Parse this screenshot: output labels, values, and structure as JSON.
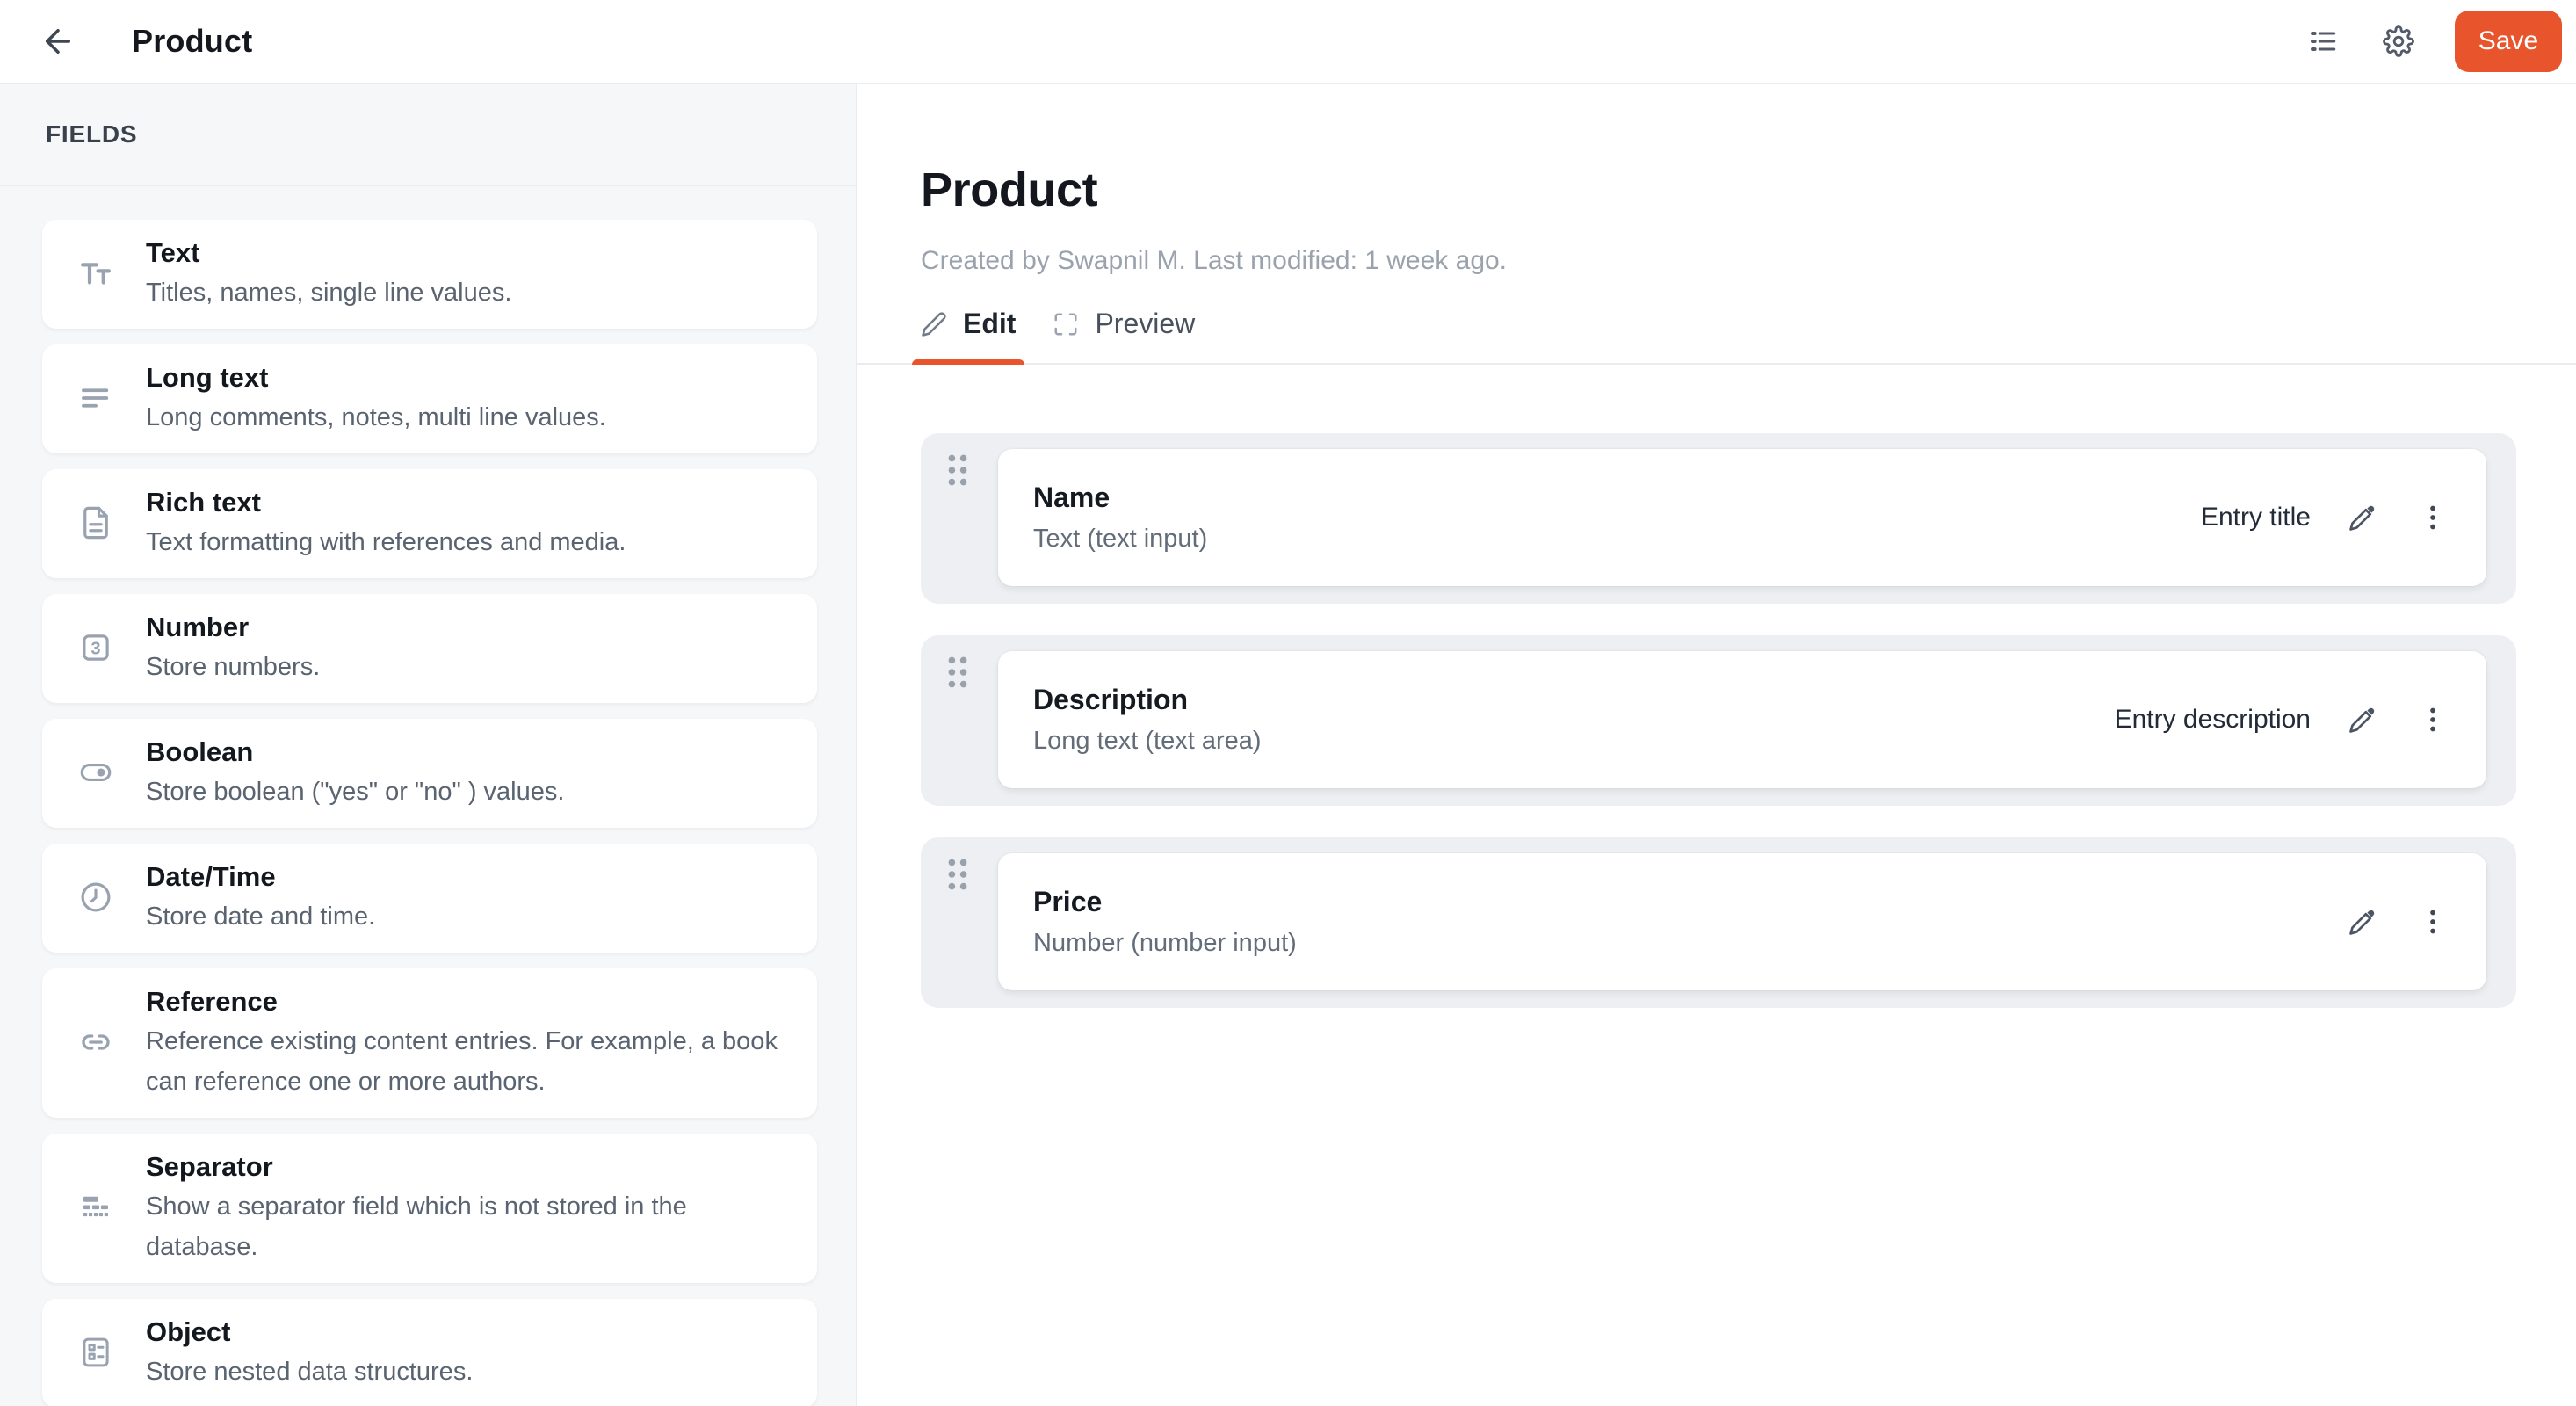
{
  "colors": {
    "accent": "#E8552D"
  },
  "topbar": {
    "back_icon": "arrow-left-icon",
    "title": "Product",
    "list_icon": "list-icon",
    "gear_icon": "gear-icon",
    "save_label": "Save"
  },
  "sidebar": {
    "header": "FIELDS",
    "items": [
      {
        "icon": "text-icon",
        "title": "Text",
        "description": "Titles, names, single line values."
      },
      {
        "icon": "long-text-icon",
        "title": "Long text",
        "description": "Long comments, notes, multi line values."
      },
      {
        "icon": "rich-text-icon",
        "title": "Rich text",
        "description": "Text formatting with references and media."
      },
      {
        "icon": "number-icon",
        "title": "Number",
        "description": "Store numbers."
      },
      {
        "icon": "boolean-icon",
        "title": "Boolean",
        "description": "Store boolean (\"yes\" or \"no\" ) values."
      },
      {
        "icon": "datetime-icon",
        "title": "Date/Time",
        "description": "Store date and time."
      },
      {
        "icon": "reference-icon",
        "title": "Reference",
        "description": "Reference existing content entries. For example, a book can reference one or more authors."
      },
      {
        "icon": "separator-icon",
        "title": "Separator",
        "description": "Show a separator field which is not stored in the database."
      },
      {
        "icon": "object-icon",
        "title": "Object",
        "description": "Store nested data structures."
      }
    ]
  },
  "main": {
    "title": "Product",
    "meta": "Created by Swapnil M. Last modified: 1 week ago.",
    "tabs": [
      {
        "icon": "pencil-icon",
        "label": "Edit",
        "active": true
      },
      {
        "icon": "expand-icon",
        "label": "Preview",
        "active": false
      }
    ],
    "fields": [
      {
        "title": "Name",
        "subtitle": "Text (text input)",
        "badge": "Entry title"
      },
      {
        "title": "Description",
        "subtitle": "Long text (text area)",
        "badge": "Entry description"
      },
      {
        "title": "Price",
        "subtitle": "Number (number input)",
        "badge": ""
      }
    ]
  }
}
